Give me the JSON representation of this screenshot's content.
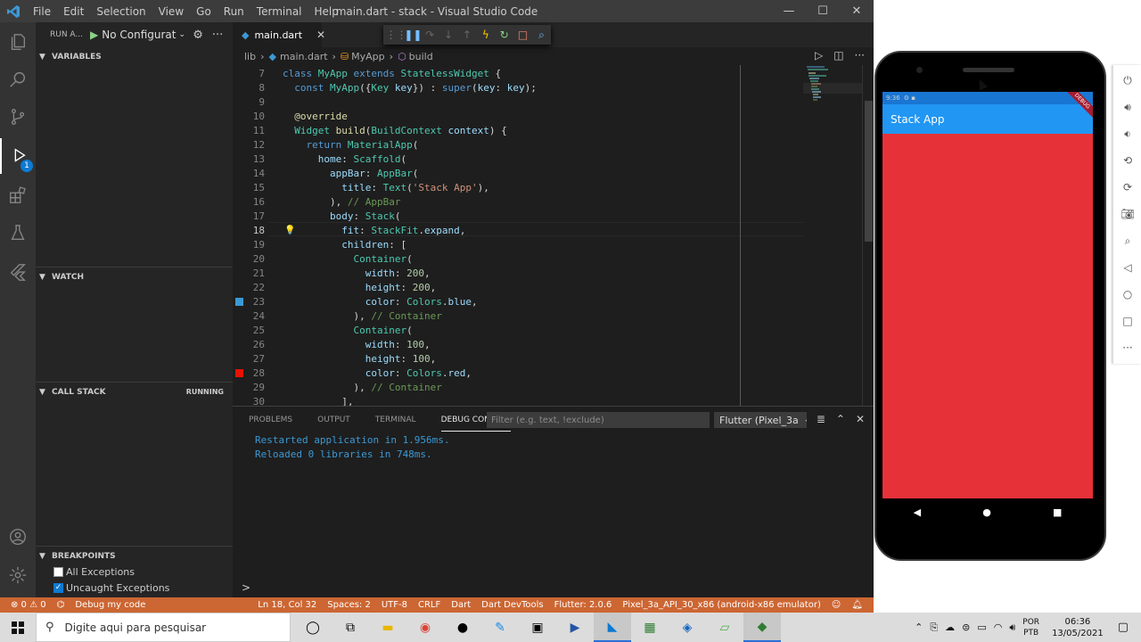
{
  "window": {
    "title": "main.dart - stack - Visual Studio Code",
    "menu": [
      "File",
      "Edit",
      "Selection",
      "View",
      "Go",
      "Run",
      "Terminal",
      "Help"
    ]
  },
  "sidebar": {
    "run_label": "RUN A...",
    "config": "No Configurat",
    "sections": {
      "variables": "VARIABLES",
      "watch": "WATCH",
      "call_stack": "CALL STACK",
      "call_stack_status": "RUNNING",
      "breakpoints": "BREAKPOINTS"
    },
    "breakpoints": [
      {
        "label": "All Exceptions",
        "checked": false
      },
      {
        "label": "Uncaught Exceptions",
        "checked": true
      }
    ],
    "badge": "1"
  },
  "tab": {
    "label": "main.dart"
  },
  "breadcrumb": [
    "lib",
    "main.dart",
    "MyApp",
    "build"
  ],
  "code": {
    "current_line": 18,
    "lines": [
      {
        "n": "7"
      },
      {
        "n": "8"
      },
      {
        "n": "9"
      },
      {
        "n": "10"
      },
      {
        "n": "11"
      },
      {
        "n": "12"
      },
      {
        "n": "13"
      },
      {
        "n": "14"
      },
      {
        "n": "15"
      },
      {
        "n": "16"
      },
      {
        "n": "17"
      },
      {
        "n": "18"
      },
      {
        "n": "19"
      },
      {
        "n": "20"
      },
      {
        "n": "21"
      },
      {
        "n": "22"
      },
      {
        "n": "23"
      },
      {
        "n": "24"
      },
      {
        "n": "25"
      },
      {
        "n": "26"
      },
      {
        "n": "27"
      },
      {
        "n": "28"
      },
      {
        "n": "29"
      },
      {
        "n": "30"
      }
    ],
    "breakpoint_colors": {
      "blue": "#3c99d4",
      "red": "#e51400"
    }
  },
  "panel": {
    "tabs": [
      "PROBLEMS",
      "OUTPUT",
      "TERMINAL",
      "DEBUG CONSOLE"
    ],
    "active_tab": "DEBUG CONSOLE",
    "filter_placeholder": "Filter (e.g. text, !exclude)",
    "session": "Flutter (Pixel_3a",
    "console": [
      "Restarted application in 1.956ms.",
      "Reloaded 0 libraries in 748ms."
    ],
    "prompt": ">"
  },
  "statusbar": {
    "problems": "⊗ 0 ⚠ 0",
    "debug": "Debug my code",
    "position": "Ln 18, Col 32",
    "spaces": "Spaces: 2",
    "encoding": "UTF-8",
    "eol": "CRLF",
    "language": "Dart",
    "devtools": "Dart DevTools",
    "flutter": "Flutter: 2.0.6",
    "device": "Pixel_3a_API_30_x86 (android-x86 emulator)",
    "color": "#cc6633"
  },
  "phone": {
    "time": "9:36",
    "app_title": "Stack App",
    "debug_label": "DEBUG",
    "body_color": "#e73139",
    "appbar_color": "#2196f3"
  },
  "taskbar": {
    "search_placeholder": "Digite aqui para pesquisar",
    "lang_top": "POR",
    "lang_bottom": "PTB",
    "time": "06:36",
    "date": "13/05/2021"
  }
}
